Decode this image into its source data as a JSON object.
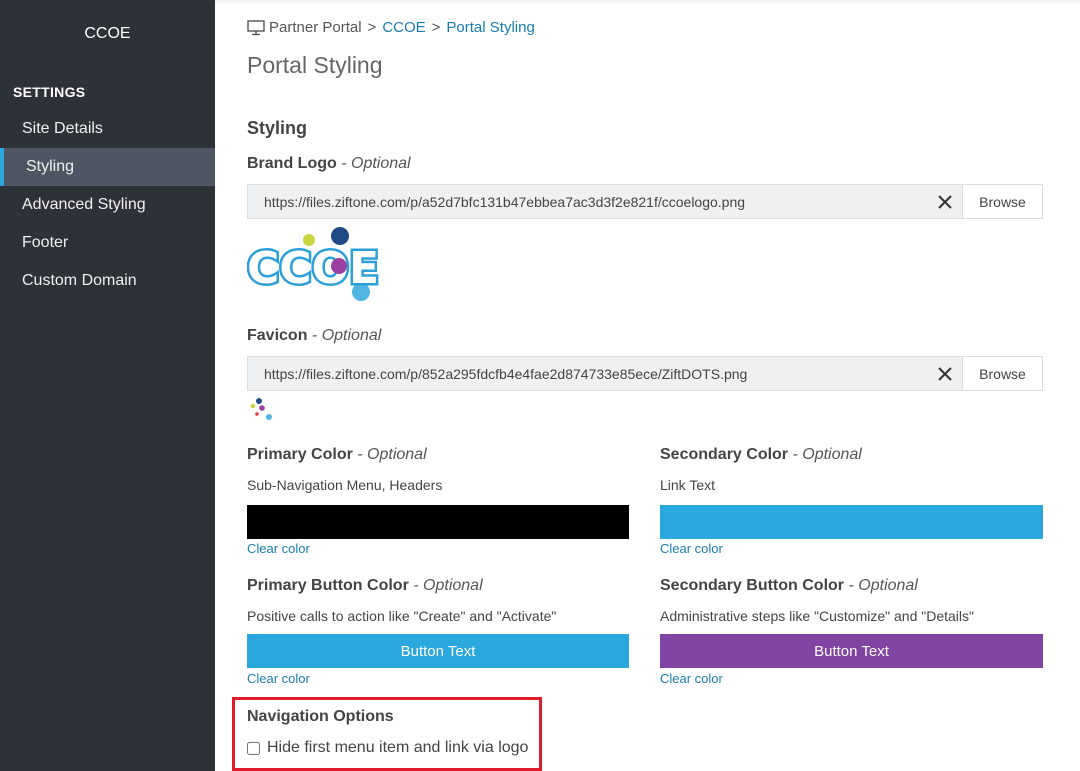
{
  "sidebar": {
    "app_name": "CCOE",
    "section_title": "SETTINGS",
    "items": [
      {
        "label": "Site Details",
        "active": false
      },
      {
        "label": "Styling",
        "active": true
      },
      {
        "label": "Advanced Styling",
        "active": false
      },
      {
        "label": "Footer",
        "active": false
      },
      {
        "label": "Custom Domain",
        "active": false
      }
    ]
  },
  "breadcrumb": {
    "icon": "monitor-icon",
    "items": [
      "Partner Portal",
      "CCOE",
      "Portal Styling"
    ],
    "separator": ">"
  },
  "page_title": "Portal Styling",
  "section_heading": "Styling",
  "optional_suffix": "- Optional",
  "brand_logo": {
    "label": "Brand Logo",
    "url": "https://files.ziftone.com/p/a52d7bfc131b47ebbea7ac3d3f2e821f/ccoelogo.png",
    "browse_label": "Browse",
    "preview_text": "CCOE"
  },
  "favicon": {
    "label": "Favicon",
    "url": "https://files.ziftone.com/p/852a295fdcfb4e4fae2d874733e85ece/ZiftDOTS.png",
    "browse_label": "Browse"
  },
  "primary_color": {
    "label": "Primary Color",
    "description": "Sub-Navigation Menu, Headers",
    "color": "#000000",
    "clear_label": "Clear color"
  },
  "secondary_color": {
    "label": "Secondary Color",
    "description": "Link Text",
    "color": "#2aa7dc",
    "clear_label": "Clear color"
  },
  "primary_button_color": {
    "label": "Primary Button Color",
    "description": "Positive calls to action like \"Create\" and \"Activate\"",
    "color": "#2aa7dc",
    "button_text": "Button Text",
    "clear_label": "Clear color"
  },
  "secondary_button_color": {
    "label": "Secondary Button Color",
    "description": "Administrative steps like \"Customize\" and \"Details\"",
    "color": "#8244a3",
    "button_text": "Button Text",
    "clear_label": "Clear color"
  },
  "navigation_options": {
    "title": "Navigation Options",
    "checkbox_label": "Hide first menu item and link via logo",
    "checked": false
  },
  "colors": {
    "sidebar_bg": "#2d3138",
    "sidebar_active_bg": "#4d5662",
    "accent": "#2aa7dc",
    "link": "#1a7db0",
    "highlight_border": "#e11d2b"
  }
}
